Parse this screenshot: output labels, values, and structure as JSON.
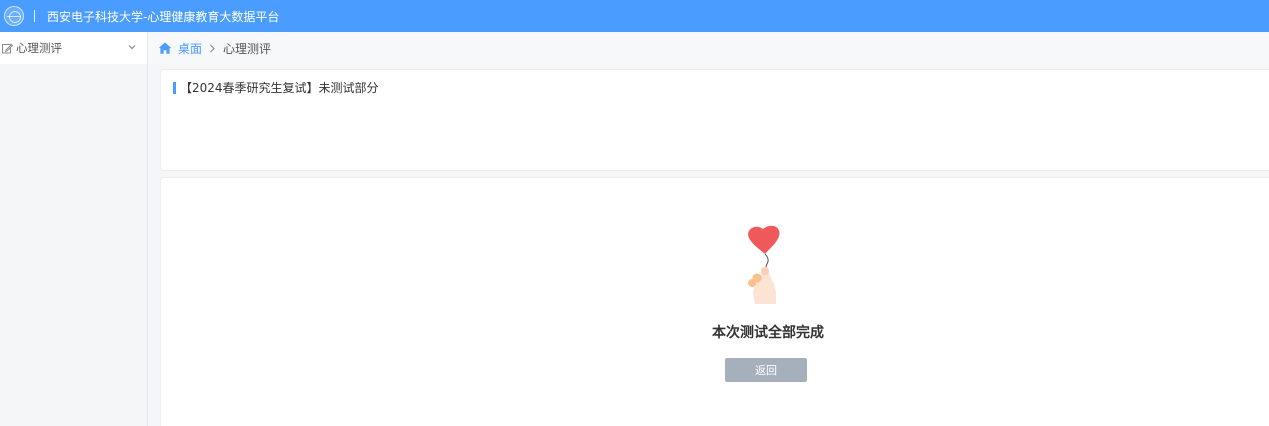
{
  "header": {
    "app_title": "西安电子科技大学-心理健康教育大数据平台",
    "logo_icon": "university-seal-icon"
  },
  "sidebar": {
    "items": [
      {
        "label": "心理测评",
        "icon": "edit-icon",
        "expanded": true
      }
    ]
  },
  "breadcrumb": {
    "home": "桌面",
    "current": "心理测评"
  },
  "test_card": {
    "title": "【2024春季研究生复试】未测试部分"
  },
  "result": {
    "message": "本次测试全部完成",
    "back_label": "返回"
  },
  "colors": {
    "accent": "#4a9dff",
    "button": "#a6b0bd",
    "heart": "#f0595a"
  }
}
